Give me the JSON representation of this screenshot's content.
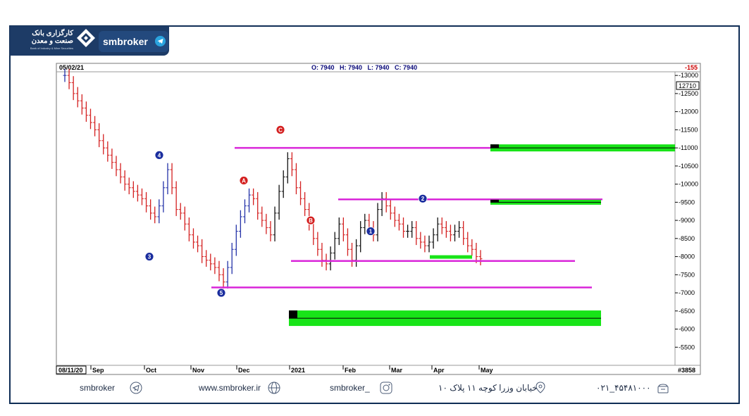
{
  "brand": {
    "logo_fa": "کارگزاری بانک صنعت و معدن",
    "logo_en": "Bank of Industry & Mine Securities",
    "name": "smbroker",
    "telegram_icon": "telegram-icon"
  },
  "header": {
    "date": "05/02/21",
    "ohlc": "O: 7940   H: 7940   L: 7940   C: 7940",
    "change": "-155"
  },
  "footer": {
    "telegram": "smbroker",
    "website": "www.smbroker.ir",
    "instagram": "smbroker_",
    "address": "خیابان وزرا کوچه ۱۱ پلاک ۱۰",
    "phone": "۰۲۱_۴۵۴۸۱۰۰۰"
  },
  "chart_data": {
    "type": "bar",
    "y_ticks": [
      13000,
      12500,
      12000,
      11500,
      11000,
      10500,
      10000,
      9500,
      9000,
      8500,
      8000,
      7500,
      7000,
      6500,
      6000,
      5500
    ],
    "y_current": "12710",
    "ylim": [
      5000,
      13100
    ],
    "x_start_label": "08/11/20",
    "x_labels": [
      "Sep",
      "Oct",
      "Nov",
      "Dec",
      "2021",
      "Feb",
      "Mar",
      "Apr",
      "May"
    ],
    "volume_label": "#3858",
    "support_resistance_lines": [
      {
        "price": 11000,
        "color": "#d926d9"
      },
      {
        "price": 9580,
        "color": "#d926d9"
      },
      {
        "price": 7880,
        "color": "#d926d9"
      },
      {
        "price": 7150,
        "color": "#d926d9"
      }
    ],
    "targets_right": [
      {
        "price": 11000,
        "color": "#18e418"
      },
      {
        "price": 9500,
        "color": "#18e418"
      },
      {
        "price": 6300,
        "color": "#18e418"
      }
    ],
    "price_series_approx": [
      13000,
      12800,
      12500,
      12300,
      12100,
      11900,
      11700,
      11500,
      11200,
      11000,
      10800,
      10600,
      10400,
      10200,
      10000,
      9900,
      9800,
      9700,
      9600,
      9400,
      9200,
      9100,
      9400,
      9900,
      10400,
      9900,
      9300,
      9200,
      8900,
      8600,
      8400,
      8300,
      8000,
      7900,
      7800,
      7700,
      7500,
      7300,
      7700,
      8200,
      8700,
      9100,
      9400,
      9700,
      9600,
      9200,
      9000,
      8800,
      8600,
      9200,
      9800,
      10200,
      10700,
      10400,
      9900,
      9600,
      9300,
      8900,
      8500,
      8200,
      7900,
      7800,
      8100,
      8500,
      8900,
      8600,
      8200,
      7900,
      8300,
      8800,
      9000,
      8800,
      8600,
      9300,
      9600,
      9400,
      9200,
      9000,
      8900,
      8700,
      8700,
      8800,
      8500,
      8400,
      8300,
      8400,
      8600,
      8900,
      8800,
      8700,
      8600,
      8700,
      8800,
      8500,
      8300,
      8200,
      8000,
      7940
    ],
    "wave_labels": [
      {
        "text": "5",
        "style": "circle-blue"
      },
      {
        "text": "4",
        "style": "circle-blue"
      },
      {
        "text": "3",
        "style": "circle-blue"
      },
      {
        "text": "C",
        "style": "circle-red"
      },
      {
        "text": "A",
        "style": "circle-red"
      },
      {
        "text": "B",
        "style": "circle-red"
      },
      {
        "text": "1",
        "style": "circle-blue"
      },
      {
        "text": "2",
        "style": "circle-blue"
      }
    ]
  }
}
